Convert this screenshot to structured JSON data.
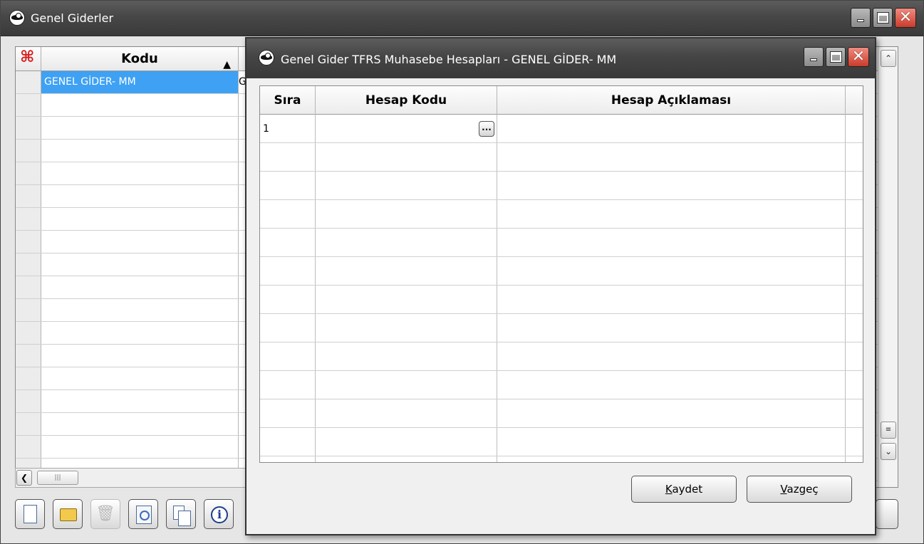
{
  "main_window": {
    "title": "Genel Giderler",
    "grid": {
      "column_kodu": "Kodu",
      "selected_row_value": "GENEL GİDER- MM",
      "second_column_clip": "G"
    }
  },
  "dialog": {
    "title": "Genel Gider TFRS Muhasebe Hesapları - GENEL GİDER- MM",
    "columns": {
      "sira": "Sıra",
      "hesap_kodu": "Hesap Kodu",
      "hesap_aciklamasi": "Hesap Açıklaması"
    },
    "rows": [
      {
        "sira": "1",
        "hesap_kodu": "",
        "hesap_aciklamasi": ""
      }
    ],
    "ellipsis_label": "...",
    "buttons": {
      "save_accel": "K",
      "save_rest": "aydet",
      "cancel_accel": "V",
      "cancel_rest": "azgeç"
    }
  },
  "colors": {
    "selection": "#3ea1f4",
    "titlebar": "#474747",
    "close_button": "#cc3b2b"
  }
}
